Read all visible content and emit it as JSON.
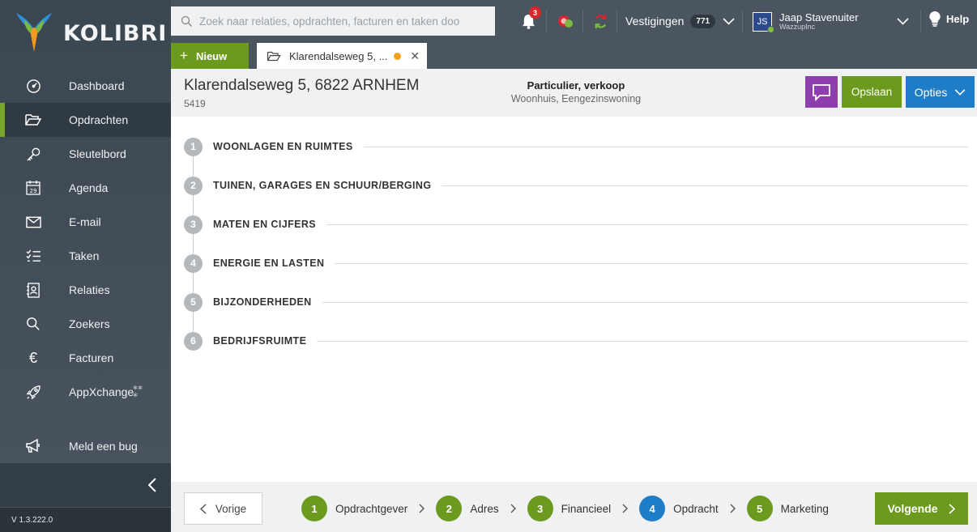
{
  "app": {
    "logo_text": "KOLIBRI",
    "version": "V 1.3.222.0"
  },
  "sidebar": {
    "items": [
      {
        "label": "Dashboard",
        "icon": "dashboard-gauge-icon"
      },
      {
        "label": "Opdrachten",
        "icon": "folder-open-icon",
        "active": true
      },
      {
        "label": "Sleutelbord",
        "icon": "key-icon"
      },
      {
        "label": "Agenda",
        "icon": "calendar-icon",
        "icon_text": "29"
      },
      {
        "label": "E-mail",
        "icon": "envelope-icon"
      },
      {
        "label": "Taken",
        "icon": "checklist-icon"
      },
      {
        "label": "Relaties",
        "icon": "contact-card-icon"
      },
      {
        "label": "Zoekers",
        "icon": "search-icon"
      },
      {
        "label": "Facturen",
        "icon": "euro-icon",
        "icon_text": "€"
      },
      {
        "label": "AppXchange",
        "icon": "rocket-icon"
      }
    ],
    "bug": {
      "label": "Meld een bug",
      "icon": "megaphone-icon"
    },
    "collapse_icon": "chevron-left-icon"
  },
  "topbar": {
    "search_placeholder": "Zoek naar relaties, opdrachten, facturen en taken doo",
    "notifications_count": "3",
    "vestigingen": {
      "label": "Vestigingen",
      "count": "771"
    },
    "user": {
      "initials": "JS",
      "name": "Jaap Stavenuiter",
      "company": "WazzupInc"
    },
    "help_label": "Help"
  },
  "tabs": {
    "new_label": "Nieuw",
    "open_tab_label": "Klarendalseweg 5, ..."
  },
  "record": {
    "title": "Klarendalseweg 5, 6822 ARNHEM",
    "id": "5419",
    "type": "Particulier, verkoop",
    "subtype": "Woonhuis, Eengezinswoning",
    "save_label": "Opslaan",
    "options_label": "Opties"
  },
  "sections": [
    {
      "num": "1",
      "label": "WOONLAGEN EN RUIMTES"
    },
    {
      "num": "2",
      "label": "TUINEN, GARAGES EN SCHUUR/BERGING"
    },
    {
      "num": "3",
      "label": "MATEN EN CIJFERS"
    },
    {
      "num": "4",
      "label": "ENERGIE EN LASTEN"
    },
    {
      "num": "5",
      "label": "BIJZONDERHEDEN"
    },
    {
      "num": "6",
      "label": "BEDRIJFSRUIMTE"
    }
  ],
  "wizard": {
    "prev_label": "Vorige",
    "next_label": "Volgende",
    "steps": [
      {
        "num": "1",
        "label": "Opdrachtgever",
        "state": "done"
      },
      {
        "num": "2",
        "label": "Adres",
        "state": "done"
      },
      {
        "num": "3",
        "label": "Financieel",
        "state": "done"
      },
      {
        "num": "4",
        "label": "Opdracht",
        "state": "current"
      },
      {
        "num": "5",
        "label": "Marketing",
        "state": "done"
      }
    ]
  },
  "colors": {
    "green": "#6c9a1f",
    "blue": "#1f7dc8",
    "purple": "#8e3fad",
    "sidebar": "#3a4650",
    "accent_active": "#7aa72b",
    "badge_red": "#d8262e"
  }
}
